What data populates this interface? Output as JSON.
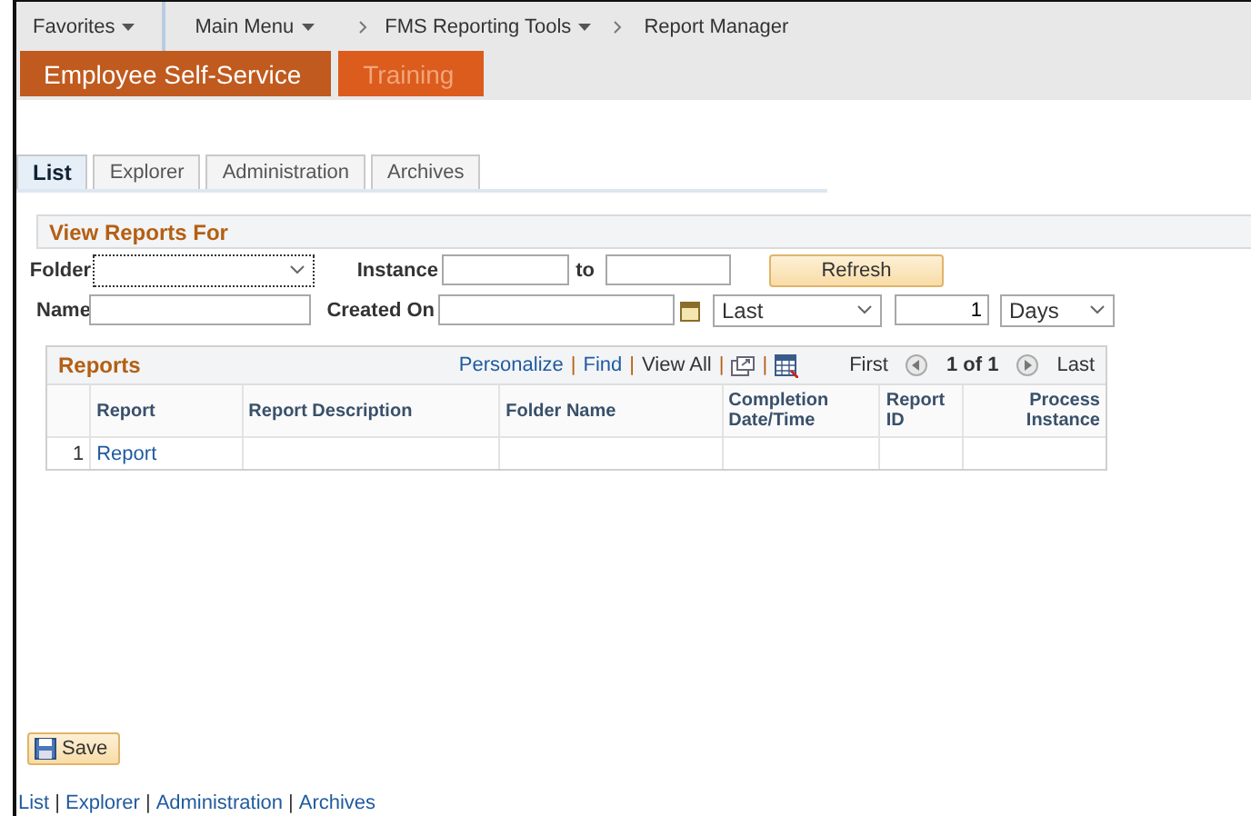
{
  "nav": [
    {
      "label": "Favorites",
      "kind": "menu"
    },
    {
      "label": "Main Menu",
      "kind": "menu"
    },
    {
      "label": "FMS Reporting Tools",
      "kind": "crumb-menu"
    },
    {
      "label": "Report Manager",
      "kind": "crumb"
    }
  ],
  "homepage_tabs": [
    {
      "label": "Employee Self-Service",
      "selected": true
    },
    {
      "label": "Training",
      "selected": false
    }
  ],
  "tabs": [
    {
      "label": "List",
      "selected": true
    },
    {
      "label": "Explorer",
      "selected": false
    },
    {
      "label": "Administration",
      "selected": false
    },
    {
      "label": "Archives",
      "selected": false
    }
  ],
  "filters": {
    "title": "View Reports For",
    "folder": {
      "label": "Folder"
    },
    "instance": {
      "label": "Instance",
      "to_label": "to"
    },
    "refresh": "Refresh",
    "name": {
      "label": "Name"
    },
    "created_on": {
      "label": "Created On",
      "period": "Last",
      "count": "1",
      "unit": "Days"
    }
  },
  "grid": {
    "title": "Reports",
    "separator": "|",
    "links": [
      "Personalize",
      "Find",
      "View All"
    ],
    "first": "First",
    "range": "1 of 1",
    "last": "Last",
    "columns": [
      "Report",
      "Report Description",
      "Folder Name",
      "Completion Date/Time",
      "Report ID",
      "Process Instance"
    ],
    "rows": [
      {
        "number": "1",
        "report": "Report"
      }
    ]
  },
  "save": "Save",
  "footer_separator": "|",
  "footer_links": [
    "List",
    "Explorer",
    "Administration",
    "Archives"
  ]
}
